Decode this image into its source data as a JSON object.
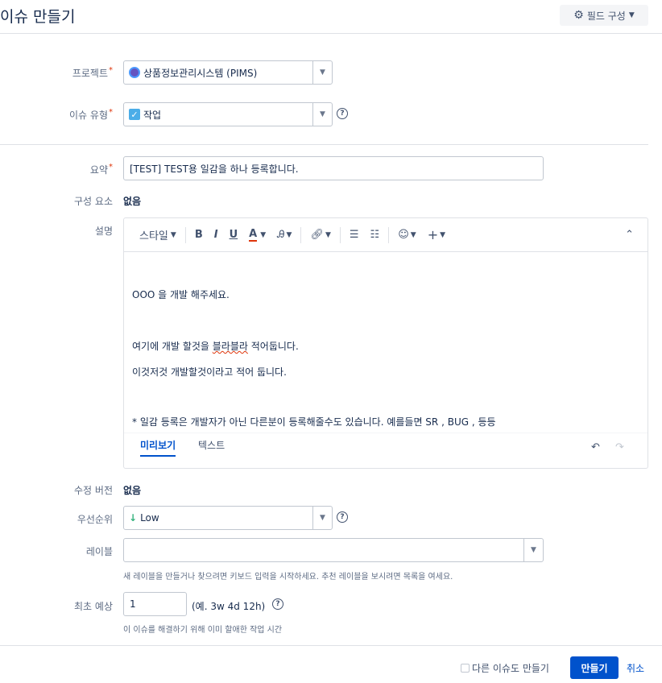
{
  "dialog": {
    "title": "이슈 만들기",
    "configure_label": "필드 구성"
  },
  "fields": {
    "project": {
      "label": "프로젝트",
      "value": "상품정보관리시스템 (PIMS)"
    },
    "issue_type": {
      "label": "이슈 유형",
      "value": "작업"
    },
    "summary": {
      "label": "요약",
      "value": "[TEST] TEST용 일감을 하나 등록합니다."
    },
    "component": {
      "label": "구성 요소",
      "value": "없음"
    },
    "description": {
      "label": "설명",
      "toolbar": {
        "style": "스타일",
        "bold": "B",
        "italic": "I",
        "underline": "U",
        "color": "A"
      },
      "lines": [
        "OOO 을 개발 해주세요.",
        "여기에 개발 할것을 ",
        "블라블라",
        " 적어둡니다.",
        "이것저것 개발할것이라고 적어 둡니다.",
        "* 일감 등록은 개발자가 아닌 다른분이 등록해줄수도 있습니다. 예를들면 SR , BUG , 등등"
      ],
      "tabs": {
        "preview": "미리보기",
        "text": "텍스트"
      }
    },
    "fix_version": {
      "label": "수정 버전",
      "value": "없음"
    },
    "priority": {
      "label": "우선순위",
      "value": "Low",
      "color": "#36b37e"
    },
    "labels": {
      "label": "레이블",
      "value": "",
      "hint": "새 레이블을 만들거나 찾으려면 키보드 입력을 시작하세요. 추천 레이블을 보시려면 목록을 여세요."
    },
    "estimate": {
      "label": "최초 예상",
      "value": "1",
      "example": "(예. 3w 4d 12h)",
      "hint": "이 이슈를 해결하기 위해 이미 할애한 작업 시간"
    }
  },
  "footer": {
    "create_another": "다른 이슈도 만들기",
    "create": "만들기",
    "cancel": "취소"
  },
  "colors": {
    "accent": "#0052cc",
    "required": "#de350b"
  }
}
